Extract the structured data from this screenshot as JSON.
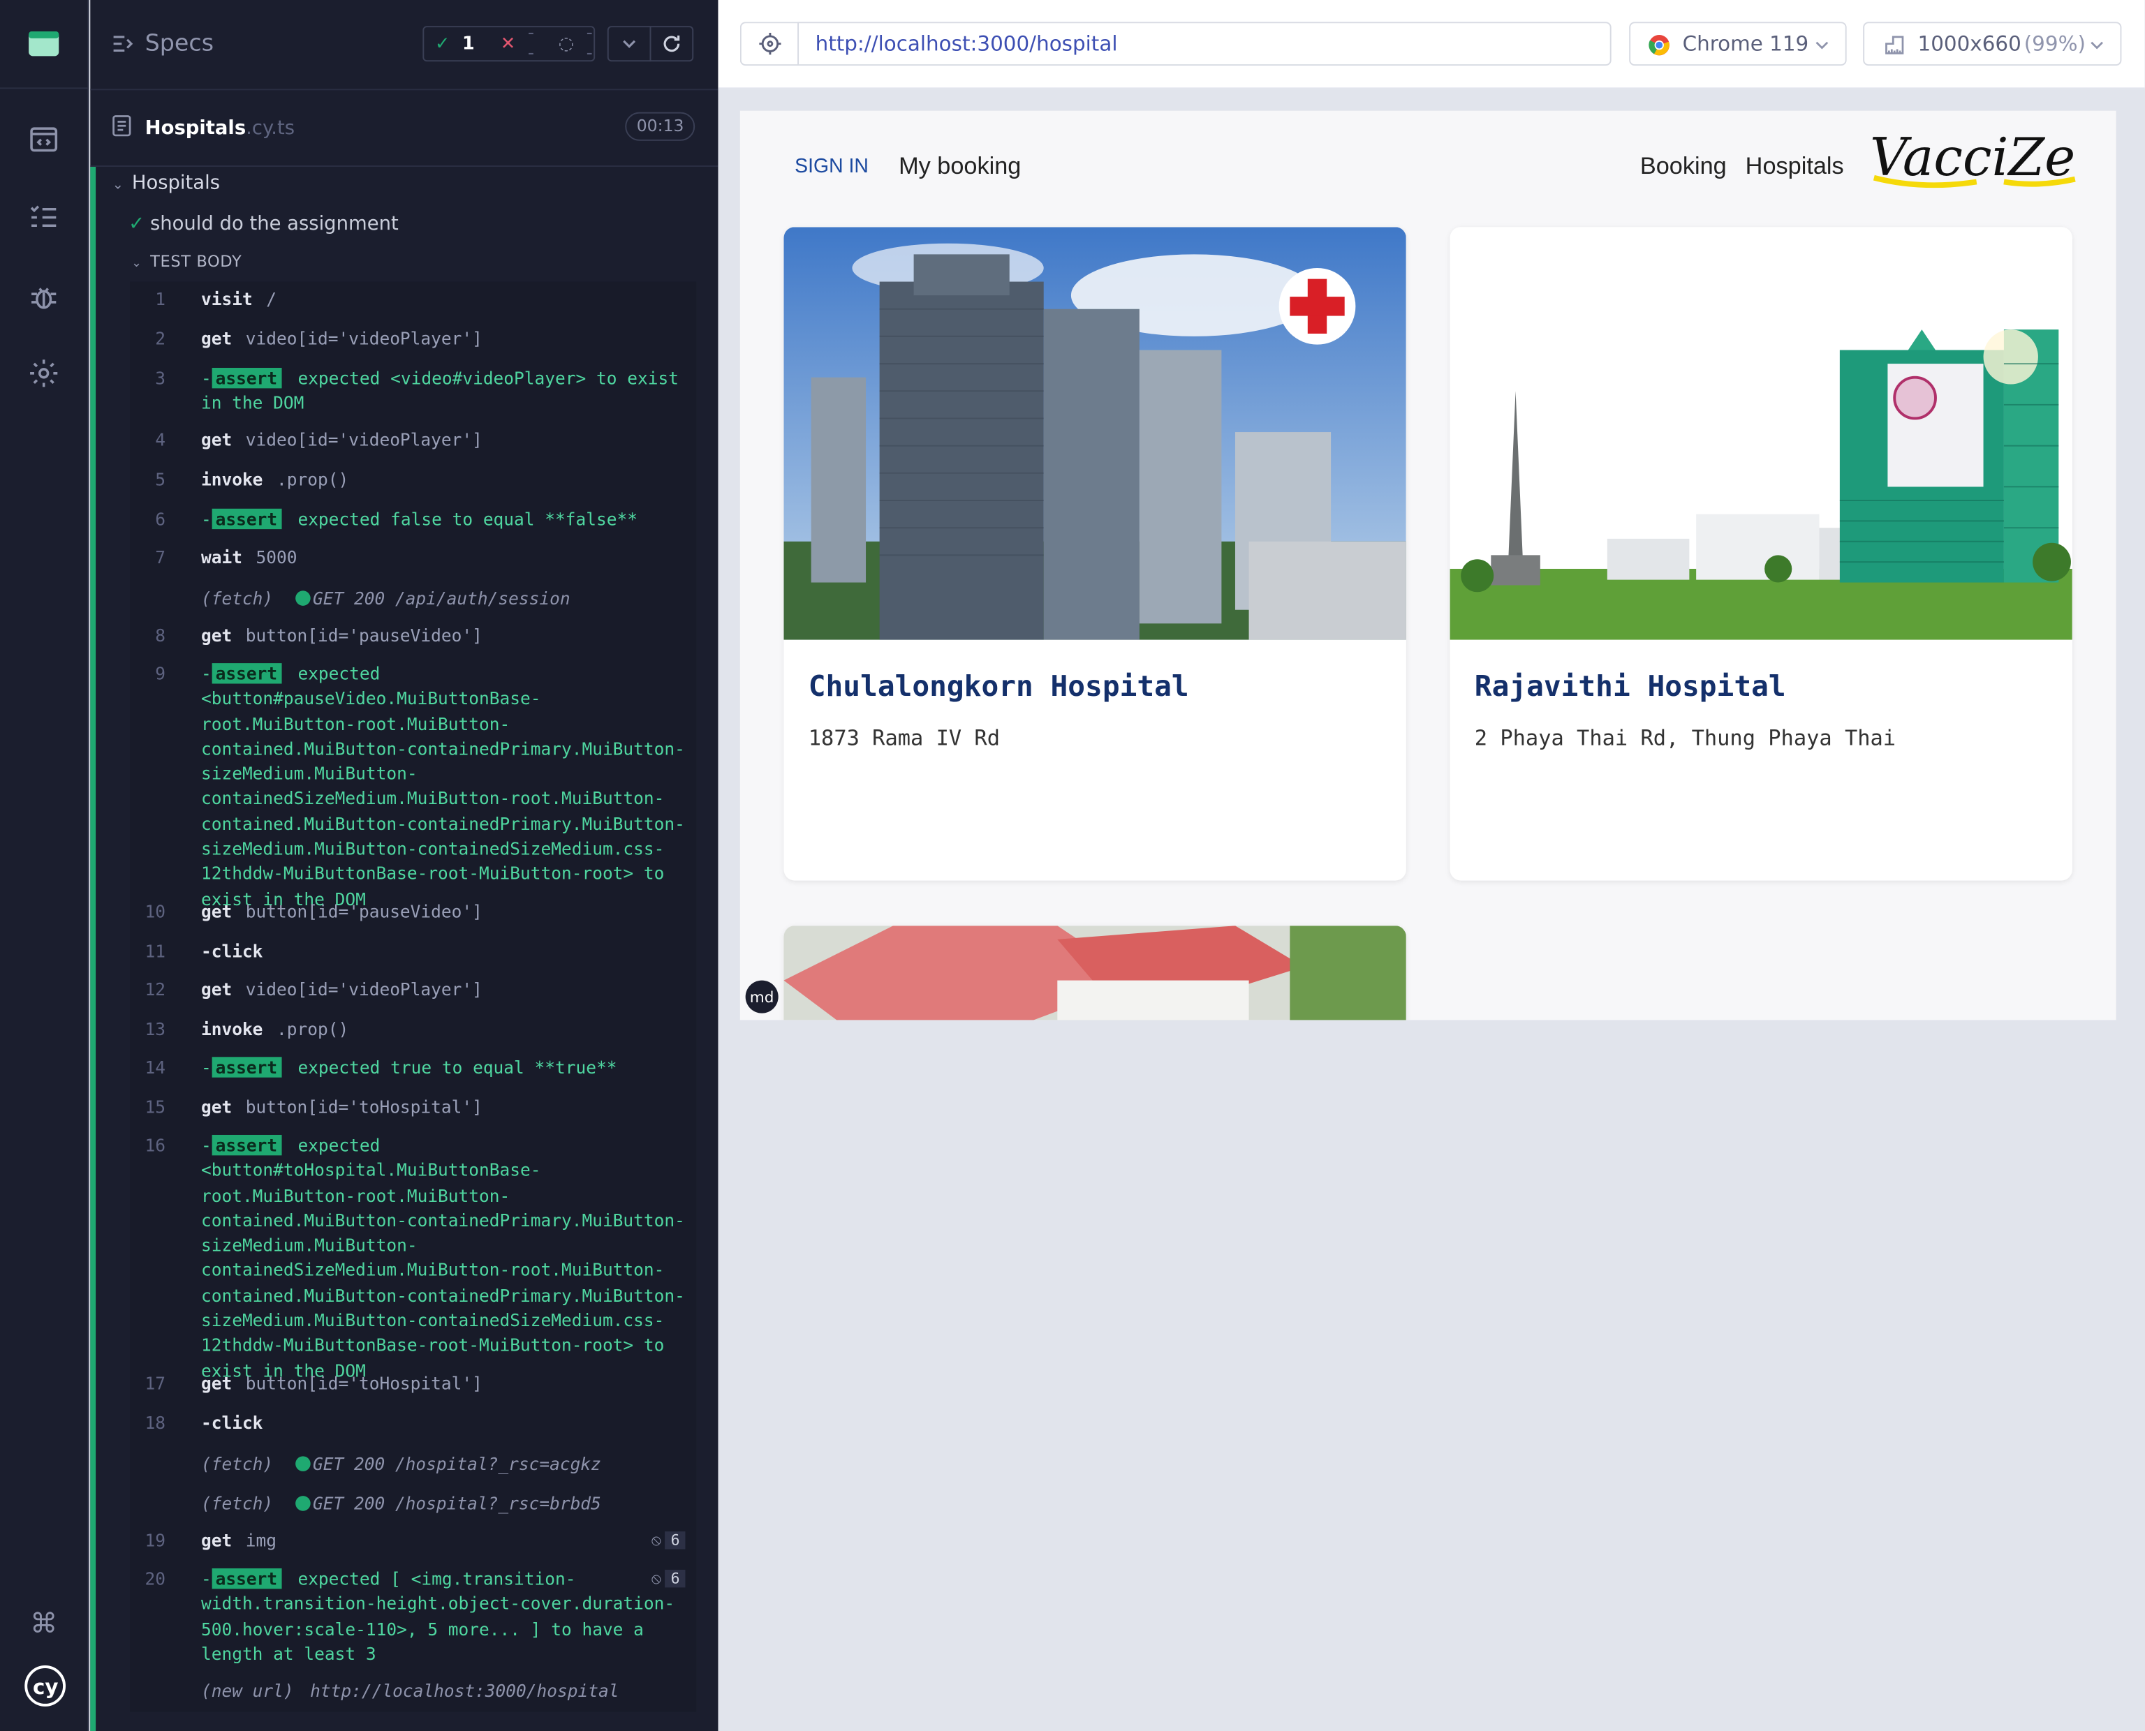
{
  "reporter": {
    "title": "Specs",
    "stats": {
      "passed": "1",
      "failed": "--",
      "pending": "--"
    },
    "spec": {
      "name": "Hospitals",
      "ext": ".cy.ts",
      "duration": "00:13"
    },
    "suite": "Hospitals",
    "test": "should do the assignment",
    "test_body": "TEST BODY",
    "commands": [
      {
        "n": "1",
        "name": "visit",
        "arg": "/"
      },
      {
        "n": "2",
        "name": "get",
        "arg": "video[id='videoPlayer']"
      },
      {
        "n": "3",
        "assert": "assert",
        "text": "expected <video#videoPlayer> to exist in the DOM"
      },
      {
        "n": "4",
        "name": "get",
        "arg": "video[id='videoPlayer']"
      },
      {
        "n": "5",
        "name": "invoke",
        "arg": ".prop()"
      },
      {
        "n": "6",
        "assert": "assert",
        "text": "expected false to equal **false**"
      },
      {
        "n": "7",
        "name": "wait",
        "arg": "5000"
      },
      {
        "fetch": "(fetch)",
        "text": "GET 200 /api/auth/session"
      },
      {
        "n": "8",
        "name": "get",
        "arg": "button[id='pauseVideo']"
      },
      {
        "n": "9",
        "assert": "assert",
        "text": "expected <button#pauseVideo.MuiButtonBase-root.MuiButton-root.MuiButton-contained.MuiButton-containedPrimary.MuiButton-sizeMedium.MuiButton-containedSizeMedium.MuiButton-root.MuiButton-contained.MuiButton-containedPrimary.MuiButton-sizeMedium.MuiButton-containedSizeMedium.css-12thddw-MuiButtonBase-root-MuiButton-root> to exist in the DOM"
      },
      {
        "n": "10",
        "name": "get",
        "arg": "button[id='pauseVideo']"
      },
      {
        "n": "11",
        "name": "-click",
        "arg": ""
      },
      {
        "n": "12",
        "name": "get",
        "arg": "video[id='videoPlayer']"
      },
      {
        "n": "13",
        "name": "invoke",
        "arg": ".prop()"
      },
      {
        "n": "14",
        "assert": "assert",
        "text": "expected true to equal **true**"
      },
      {
        "n": "15",
        "name": "get",
        "arg": "button[id='toHospital']"
      },
      {
        "n": "16",
        "assert": "assert",
        "text": "expected <button#toHospital.MuiButtonBase-root.MuiButton-root.MuiButton-contained.MuiButton-containedPrimary.MuiButton-sizeMedium.MuiButton-containedSizeMedium.MuiButton-root.MuiButton-contained.MuiButton-containedPrimary.MuiButton-sizeMedium.MuiButton-containedSizeMedium.css-12thddw-MuiButtonBase-root-MuiButton-root> to exist in the DOM"
      },
      {
        "n": "17",
        "name": "get",
        "arg": "button[id='toHospital']"
      },
      {
        "n": "18",
        "name": "-click",
        "arg": ""
      },
      {
        "fetch": "(fetch)",
        "text": "GET 200 /hospital?_rsc=acgkz"
      },
      {
        "fetch": "(fetch)",
        "text": "GET 200 /hospital?_rsc=brbd5"
      },
      {
        "n": "19",
        "name": "get",
        "arg": "img",
        "count": "6"
      },
      {
        "n": "20",
        "assert": "assert",
        "text": "expected [ <img.transition-width.transition-height.object-cover.duration-500.hover:scale-110>, 5 more... ] to have a length at least 3",
        "count": "6"
      },
      {
        "newurl": "(new url)",
        "text": "http://localhost:3000/hospital"
      }
    ]
  },
  "browser": {
    "url": "http://localhost:3000/hospital",
    "browser_name": "Chrome 119",
    "viewport": "1000x660",
    "zoom": "(99%)"
  },
  "app": {
    "nav": {
      "signin": "SIGN IN",
      "mybooking": "My booking",
      "booking": "Booking",
      "hospitals": "Hospitals",
      "brand": "VacciZe"
    },
    "cards": [
      {
        "name": "Chulalongkorn Hospital",
        "address": "1873 Rama IV Rd"
      },
      {
        "name": "Rajavithi Hospital",
        "address": "2 Phaya Thai Rd, Thung Phaya Thai"
      }
    ],
    "md_badge": "md"
  },
  "colors": {
    "accent": "#1fa971",
    "panel": "#1b1e2e",
    "link": "#1c4aa0",
    "card_title": "#14306b"
  }
}
